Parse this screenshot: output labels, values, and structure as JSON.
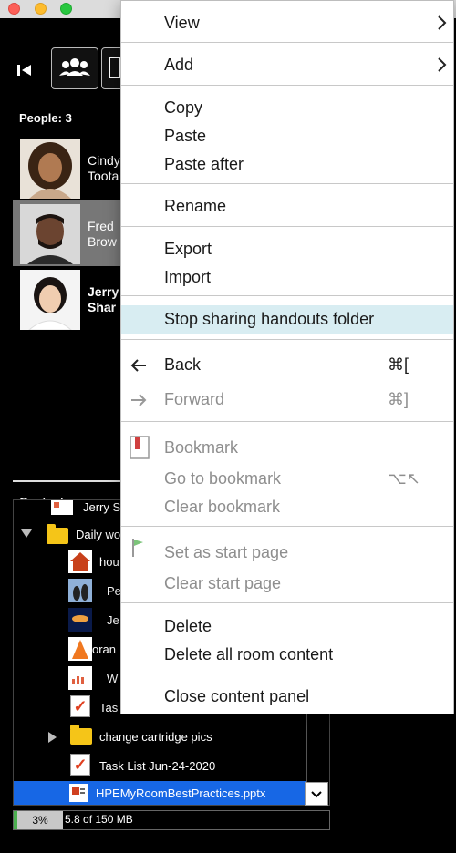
{
  "left_panel": {
    "people_count": "People: 3",
    "people": [
      {
        "name_line1": "Cindy",
        "name_line2": "Toota"
      },
      {
        "name_line1": "Fred",
        "name_line2": "Brow"
      },
      {
        "name_line1": "Jerry",
        "name_line2": "Shar"
      }
    ],
    "content_title": "Content",
    "tree": [
      {
        "label": "Jerry S"
      },
      {
        "label": "Daily wo"
      },
      {
        "label": "hou"
      },
      {
        "label": "Pe"
      },
      {
        "label": "Je"
      },
      {
        "label": "oran"
      },
      {
        "label": "W"
      },
      {
        "label": "Tas"
      },
      {
        "label": "change cartridge pics"
      },
      {
        "label": "Task List Jun-24-2020"
      }
    ],
    "selected_item": "HPEMyRoomBestPractices.pptx",
    "storage": {
      "percent_label": "3%",
      "percent": 3,
      "usage_text": "5.8 of 150 MB"
    }
  },
  "context_menu": {
    "view": "View",
    "add": "Add",
    "copy": "Copy",
    "paste": "Paste",
    "paste_after": "Paste after",
    "rename": "Rename",
    "export": "Export",
    "import": "Import",
    "stop_sharing": "Stop sharing handouts folder",
    "back": "Back",
    "back_shortcut": "⌘[",
    "forward": "Forward",
    "forward_shortcut": "⌘]",
    "bookmark": "Bookmark",
    "go_to_bookmark": "Go to bookmark",
    "go_to_bookmark_shortcut": "⌥↖",
    "clear_bookmark": "Clear bookmark",
    "set_start_page": "Set as start page",
    "clear_start_page": "Clear start page",
    "delete": "Delete",
    "delete_all": "Delete all room content",
    "close_panel": "Close content panel"
  },
  "colors": {
    "highlight": "#d8edf2",
    "selection": "#1767e5",
    "disabled_text": "#8e8e8e"
  }
}
